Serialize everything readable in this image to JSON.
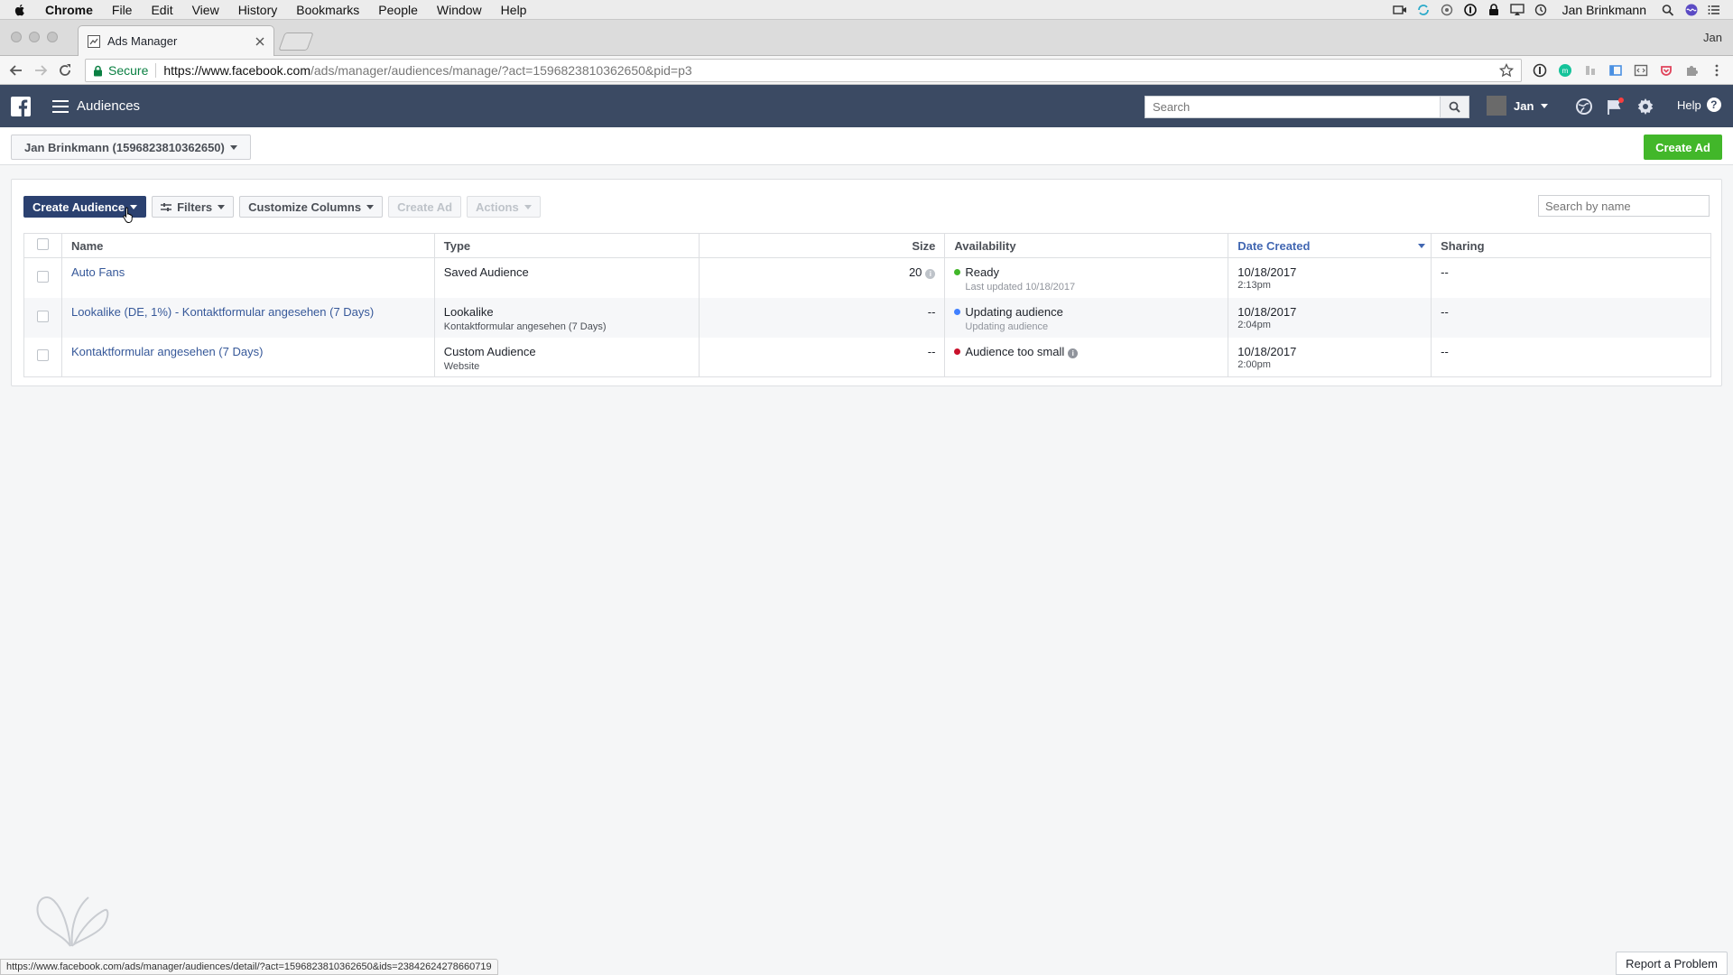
{
  "mac_menubar": {
    "app": "Chrome",
    "items": [
      "File",
      "Edit",
      "View",
      "History",
      "Bookmarks",
      "People",
      "Window",
      "Help"
    ],
    "user": "Jan Brinkmann"
  },
  "browser": {
    "tab_title": "Ads Manager",
    "profile": "Jan",
    "secure_label": "Secure",
    "url_host": "https://www.facebook.com",
    "url_path": "/ads/manager/audiences/manage/?act=1596823810362650&pid=p3"
  },
  "fbbar": {
    "title": "Audiences",
    "search_placeholder": "Search",
    "user_name": "Jan",
    "help_label": "Help",
    "help_glyph": "?"
  },
  "account": {
    "selector_label": "Jan Brinkmann (1596823810362650)",
    "create_ad_label": "Create Ad"
  },
  "toolbar": {
    "create_audience": "Create Audience",
    "filters": "Filters",
    "customize_columns": "Customize Columns",
    "create_ad": "Create Ad",
    "actions": "Actions",
    "search_placeholder": "Search by name"
  },
  "table": {
    "headers": {
      "name": "Name",
      "type": "Type",
      "size": "Size",
      "availability": "Availability",
      "date_created": "Date Created",
      "sharing": "Sharing"
    },
    "rows": [
      {
        "name": "Auto Fans",
        "type": "Saved Audience",
        "type_sub": "",
        "size": "20",
        "availability": "Ready",
        "availability_sub": "Last updated 10/18/2017",
        "status_color": "#42b72a",
        "date": "10/18/2017",
        "time": "2:13pm",
        "sharing": "--"
      },
      {
        "name": "Lookalike (DE, 1%) - Kontaktformular angesehen (7 Days)",
        "type": "Lookalike",
        "type_sub": "Kontaktformular angesehen (7 Days)",
        "size": "--",
        "availability": "Updating audience",
        "availability_sub": "Updating audience",
        "status_color": "#4080ff",
        "date": "10/18/2017",
        "time": "2:04pm",
        "sharing": "--"
      },
      {
        "name": "Kontaktformular angesehen (7 Days)",
        "type": "Custom Audience",
        "type_sub": "Website",
        "size": "--",
        "availability": "Audience too small",
        "availability_sub": "",
        "status_color": "#c9112b",
        "date": "10/18/2017",
        "time": "2:00pm",
        "sharing": "--"
      }
    ]
  },
  "footer": {
    "status_url": "https://www.facebook.com/ads/manager/audiences/detail/?act=1596823810362650&ids=23842624278660719",
    "report_problem": "Report a Problem"
  },
  "colors": {
    "fb_bar": "#3b4a63",
    "primary_button": "#2b4170",
    "create_ad_green": "#42b72a",
    "link": "#365899"
  }
}
